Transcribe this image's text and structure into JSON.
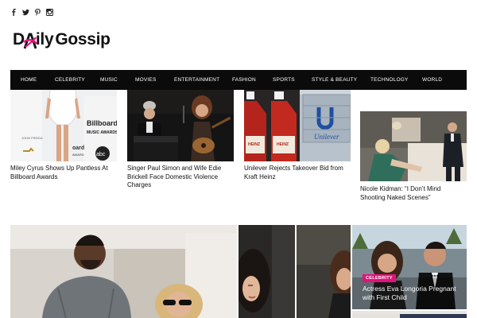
{
  "brand": {
    "logo_prefix": "D",
    "logo_suffix": "ily",
    "logo_word2": "Gossip",
    "accent_color": "#e0137a"
  },
  "social": [
    {
      "icon": "facebook-icon"
    },
    {
      "icon": "twitter-icon"
    },
    {
      "icon": "pinterest-icon"
    },
    {
      "icon": "instagram-icon"
    }
  ],
  "nav": {
    "items": [
      "HOME",
      "CELEBRITY",
      "MUSIC",
      "MOVIES",
      "ENTERTAINMENT",
      "FASHION",
      "SPORTS",
      "STYLE & BEAUTY",
      "TECHNOLOGY",
      "WORLD"
    ]
  },
  "top_articles": [
    {
      "title": "Miley Cyrus Shows Up Pantless At Billboard Awards"
    },
    {
      "title": "Singer Paul Simon and Wife Edie Brickell Face Domestic Violence Charges"
    },
    {
      "title": "Unilever Rejects Takeover Bid from Kraft Heinz"
    },
    {
      "title": "Nicole Kidman: “I Don’t Mind Shooting Naked Scenes”"
    }
  ],
  "featured": {
    "badge": "CELEBRITY",
    "title": "Actress Eva Longoria Pregnant with First Child"
  }
}
